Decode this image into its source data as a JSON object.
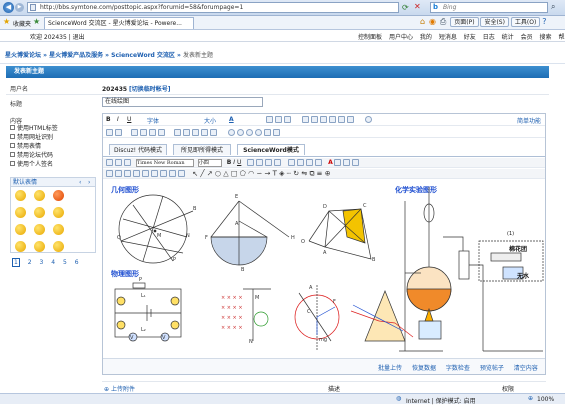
{
  "browser": {
    "url": "http://bbs.symtone.com/posttopic.aspx?forumid=58&forumpage=1",
    "search": "Bing",
    "favorites": "收藏夹",
    "tab_title": "ScienceWord 交流区 - 星火博爱论坛 - Powere...",
    "menu": [
      "页面(P)",
      "安全(S)",
      "工具(O)"
    ],
    "status_zone": "Internet | 保护模式: 启用",
    "zoom": "100%"
  },
  "site": {
    "user_line": "欢迎 202435 | 退出",
    "nav": [
      "控制面板",
      "用户中心",
      "我的",
      "短消息",
      "好友",
      "日志",
      "统计",
      "会员",
      "搜索",
      "帮助"
    ],
    "crumb": [
      "星火博爱论坛",
      "星火博爱产品及服务",
      "ScienceWord 交流区",
      "发表新主题"
    ]
  },
  "form": {
    "header": "发表新主题",
    "user_label": "用户名",
    "user_value": "202435",
    "user_extra": "[切换临时帐号]",
    "title_label": "标题",
    "title_value": "在线绘图",
    "content_label": "内容",
    "options": [
      "使用HTML标签",
      "禁用网址识别",
      "禁用表情",
      "禁用论坛代码",
      "使用个人签名"
    ],
    "emoticon_title": "默认表情",
    "pages": [
      "1",
      "2",
      "3",
      "4",
      "5",
      "6"
    ]
  },
  "editor": {
    "font_label": "字体",
    "size_label": "大小",
    "simple_mode": "简单功能",
    "tabs": [
      "Discuz! 代码模式",
      "所见即所得模式",
      "ScienceWord模式"
    ],
    "font_name": "Times New Roman",
    "font_size": "小四",
    "labels": {
      "geometry": "几何图形",
      "chemistry": "化学实验图形",
      "physics": "物理图形"
    },
    "chem_labels": [
      "棉花团",
      "无水",
      "(1)"
    ],
    "footer_buttons": [
      "批量上传",
      "恢复数据",
      "字数检查",
      "预览帖子",
      "清空内容"
    ],
    "attach": "上传附件",
    "col_desc": "描述",
    "col_perm": "权限"
  }
}
